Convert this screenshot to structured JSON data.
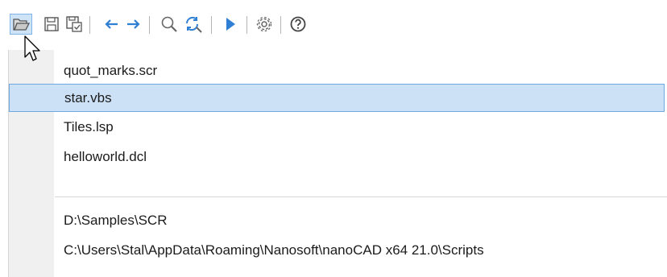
{
  "toolbar": {
    "buttons": [
      {
        "name": "open-folder-button",
        "icon": "open-folder-icon",
        "pressed": true
      },
      {
        "name": "save-button",
        "icon": "save-icon"
      },
      {
        "name": "save-as-button",
        "icon": "save-as-icon"
      },
      {
        "name": "back-button",
        "icon": "arrow-left-icon"
      },
      {
        "name": "forward-button",
        "icon": "arrow-right-icon"
      },
      {
        "name": "find-button",
        "icon": "magnifier-icon"
      },
      {
        "name": "find-replace-button",
        "icon": "find-replace-icon"
      },
      {
        "name": "run-button",
        "icon": "play-icon"
      },
      {
        "name": "settings-button",
        "icon": "gear-icon"
      },
      {
        "name": "help-button",
        "icon": "help-icon"
      }
    ]
  },
  "recent_files": {
    "items": [
      {
        "label": "quot_marks.scr"
      },
      {
        "label": "star.vbs",
        "selected": true
      },
      {
        "label": "Tiles.lsp"
      },
      {
        "label": "helloworld.dcl"
      }
    ]
  },
  "recent_folders": {
    "items": [
      {
        "label": "D:\\Samples\\SCR"
      },
      {
        "label": "C:\\Users\\Stal\\AppData\\Roaming\\Nanosoft\\nanoCAD x64 21.0\\Scripts"
      }
    ]
  },
  "colors": {
    "accent": "#2f80d4",
    "selection_fill": "#cce1f5",
    "selection_border": "#6fa7df",
    "gutter": "#f0f0f0"
  }
}
